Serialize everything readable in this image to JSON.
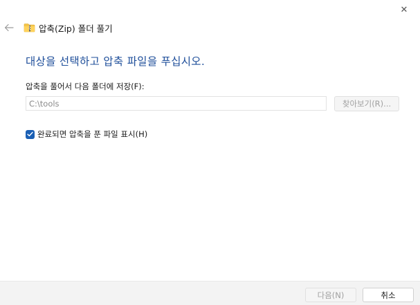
{
  "window": {
    "title": "압축(Zip) 폴더 풀기",
    "close_glyph": "✕",
    "icon": "zip-folder-icon"
  },
  "main": {
    "heading": "대상을 선택하고 압축 파일을 푸십시오.",
    "destination_label": "압축을 풀어서 다음 폴더에 저장(F):",
    "destination_value": "C:\\tools",
    "browse_label": "찾아보기(R)...",
    "show_files_label": "완료되면 압축을 푼 파일 표시(H)",
    "show_files_checked": true
  },
  "footer": {
    "next_label": "다음(N)",
    "cancel_label": "취소"
  },
  "colors": {
    "heading": "#1e4e9a",
    "checkbox_accent": "#1a5fb4",
    "footer_bg": "#f3f3f3"
  }
}
